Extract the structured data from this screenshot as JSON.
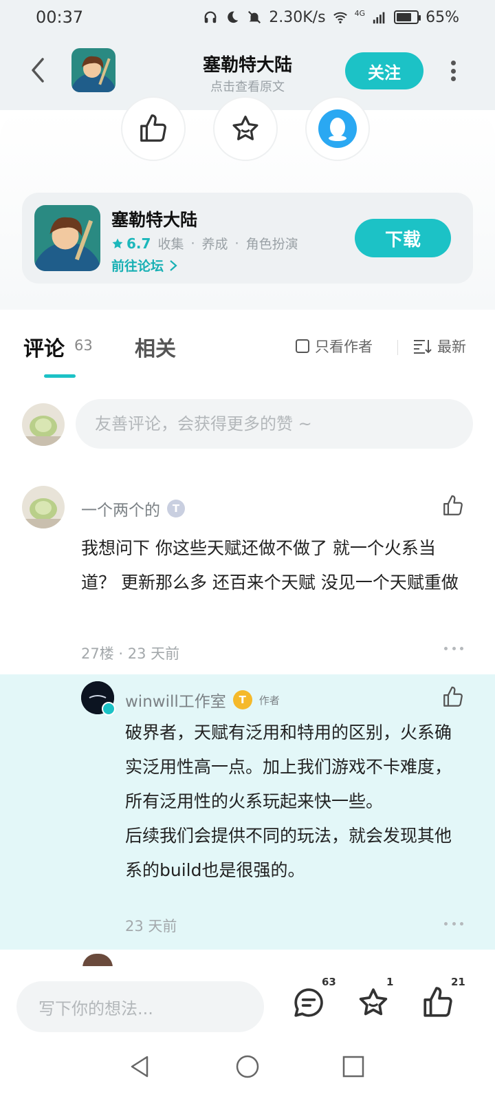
{
  "status_bar": {
    "time": "00:37",
    "network_speed": "2.30K/s",
    "signal_label": "4G",
    "battery": "65%"
  },
  "header": {
    "title": "塞勒特大陆",
    "subtitle": "点击查看原文",
    "follow_label": "关注"
  },
  "actions": {
    "like_icon": "thumbs-up-icon",
    "favorite_icon": "star-icon",
    "share_qq_icon": "qq-icon"
  },
  "app_card": {
    "name": "塞勒特大陆",
    "rating": "6.7",
    "tags": [
      "收集",
      "养成",
      "角色扮演"
    ],
    "forum_link": "前往论坛",
    "download_label": "下载"
  },
  "tabs": {
    "comments_label": "评论",
    "comments_count": "63",
    "related_label": "相关",
    "only_author_label": "只看作者",
    "sort_label": "最新"
  },
  "comment_input": {
    "placeholder": "友善评论，会获得更多的赞 ~"
  },
  "comment": {
    "username": "一个两个的",
    "badge": "T",
    "text": "我想问下 你这些天赋还做不做了 就一个火系当道？ 更新那么多 还百来个天赋 没见一个天赋重做",
    "meta": "27楼 · 23 天前"
  },
  "reply": {
    "username": "winwill工作室",
    "badge": "T",
    "author_tag": "作者",
    "text_1": "破界者，天赋有泛用和特用的区别，火系确实泛用性高一点。加上我们游戏不卡难度，所有泛用性的火系玩起来快一些。",
    "text_2": "后续我们会提供不同的玩法，就会发现其他系的build也是很强的。",
    "meta": "23 天前"
  },
  "bottom_bar": {
    "write_placeholder": "写下你的想法...",
    "comment_count": "63",
    "favorite_count": "1",
    "like_count": "21"
  },
  "colors": {
    "accent": "#1cc2c6",
    "reply_bg": "#e3f7f8",
    "header_bg": "#eef2f4"
  }
}
